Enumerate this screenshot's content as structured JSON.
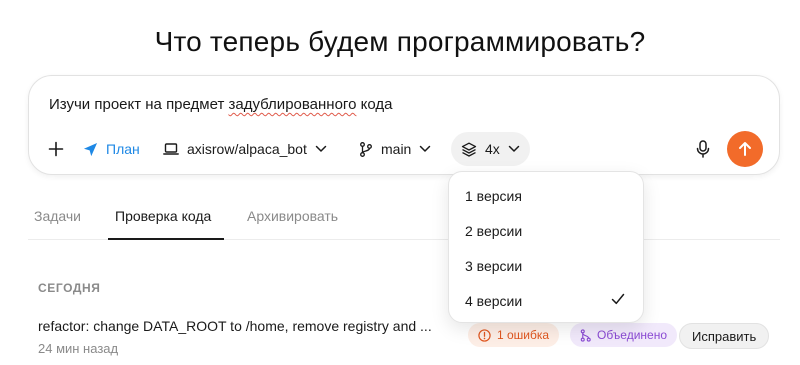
{
  "heading": "Что теперь будем программировать?",
  "composer": {
    "prompt_before": "Изучи проект на предмет ",
    "prompt_underlined": "задублированного",
    "prompt_after": " кода",
    "plan_label": "План",
    "repo_label": "axisrow/alpaca_bot",
    "branch_label": "main",
    "versions_label": "4x",
    "icons": [
      "plus-icon",
      "plan-arrow-icon",
      "laptop-icon",
      "branch-icon",
      "layers-icon",
      "chevron-down-icon",
      "microphone-icon",
      "arrow-up-icon"
    ]
  },
  "tabs": [
    {
      "label": "Задачи",
      "active": false
    },
    {
      "label": "Проверка кода",
      "active": true
    },
    {
      "label": "Архивировать",
      "active": false
    }
  ],
  "section_label": "СЕГОДНЯ",
  "task": {
    "title": "refactor: change DATA_ROOT to /home, remove registry and ...",
    "time": "24 мин назад",
    "error_badge": "1 ошибка",
    "merged_badge": "Объединено",
    "fix_label": "Исправить"
  },
  "versions_menu": {
    "options": [
      "1 версия",
      "2 версии",
      "3 версии",
      "4 версии"
    ],
    "selected": "4 версии"
  },
  "colors": {
    "accent_blue": "#1e88e5",
    "send_orange": "#f26b2a",
    "error_text": "#e0561f",
    "merged_text": "#8a4ad3"
  }
}
